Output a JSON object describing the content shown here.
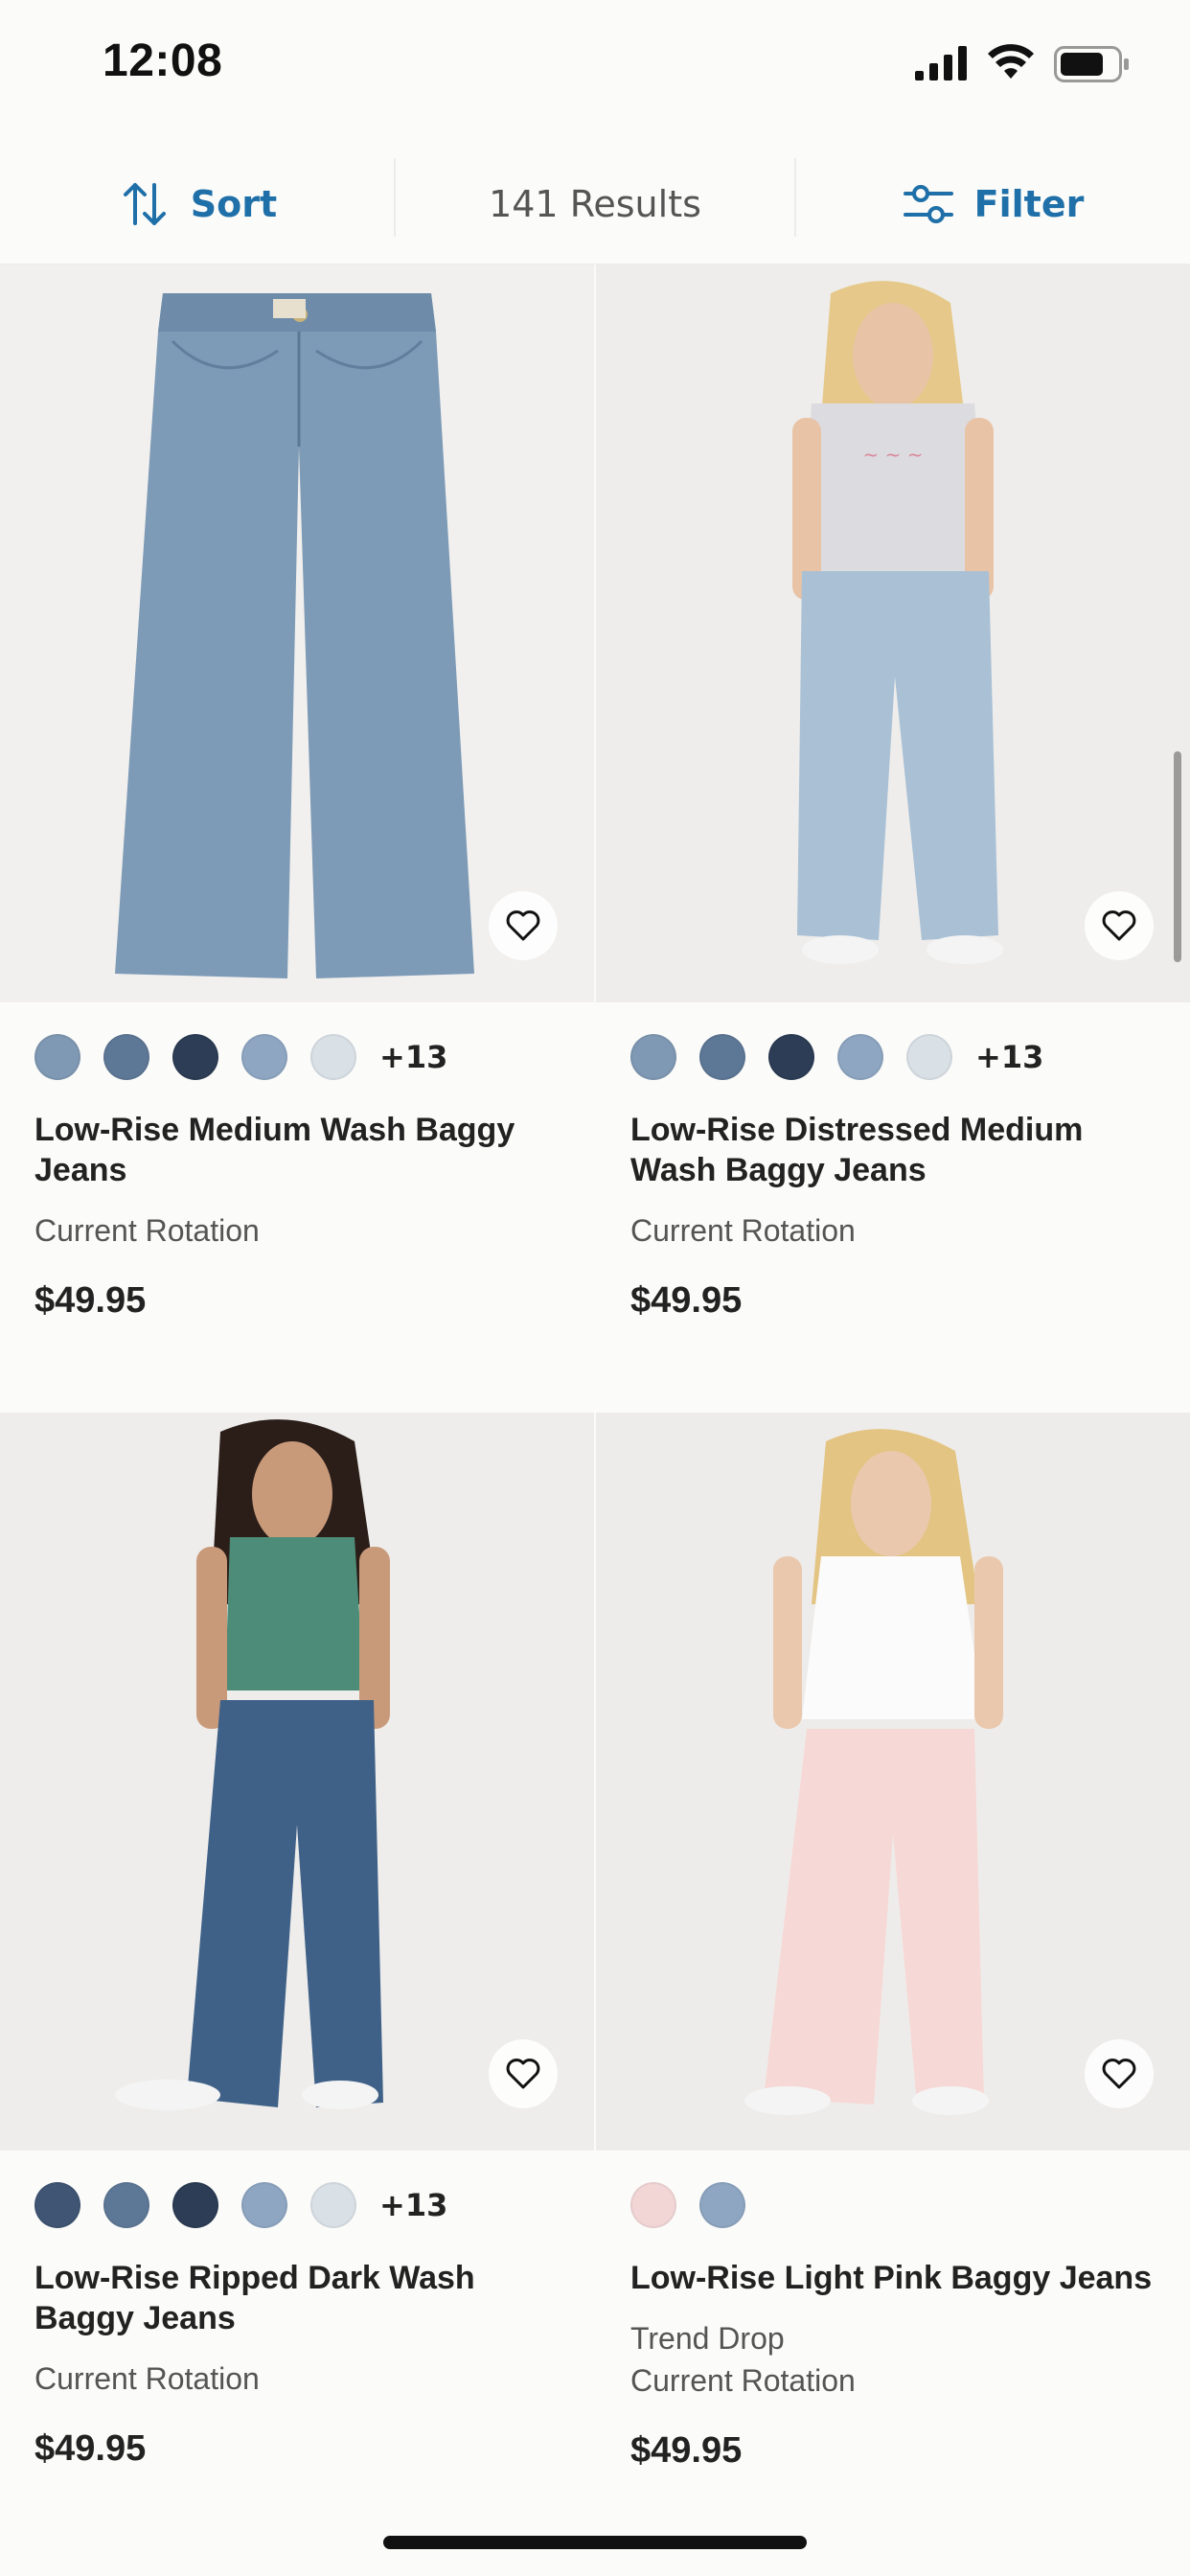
{
  "status": {
    "time": "12:08"
  },
  "toolbar": {
    "sort_label": "Sort",
    "results": "141 Results",
    "filter_label": "Filter",
    "accent": "#1f6fa8"
  },
  "products": [
    {
      "name": "Low-Rise Medium Wash Baggy Jeans",
      "tags": [
        "Current Rotation"
      ],
      "price": "$49.95",
      "swatches": [
        "#7f98b3",
        "#5d7896",
        "#2c3d55",
        "#8ea6c2",
        "#d9e0e6"
      ],
      "more": "+13"
    },
    {
      "name": "Low-Rise Distressed Medium Wash Baggy Jeans",
      "tags": [
        "Current Rotation"
      ],
      "price": "$49.95",
      "swatches": [
        "#7f98b3",
        "#5d7896",
        "#2c3d55",
        "#8ea6c2",
        "#d9e0e6"
      ],
      "more": "+13"
    },
    {
      "name": "Low-Rise Ripped Dark Wash Baggy Jeans",
      "tags": [
        "Current Rotation"
      ],
      "price": "$49.95",
      "swatches": [
        "#3f5573",
        "#5d7896",
        "#2c3d55",
        "#8ea6c2",
        "#d9e0e6"
      ],
      "more": "+13"
    },
    {
      "name": "Low-Rise Light Pink Baggy Jeans",
      "tags": [
        "Trend Drop",
        "Current Rotation"
      ],
      "price": "$49.95",
      "swatches": [
        "#f2d6d6",
        "#8ea6c2"
      ],
      "more": ""
    }
  ]
}
